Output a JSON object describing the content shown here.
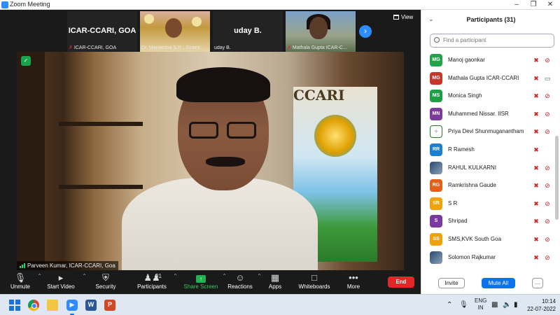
{
  "window": {
    "title": "Zoom Meeting"
  },
  "thumbnails": [
    {
      "big_name": "ICAR-CCARI, GOA",
      "label": "ICAR-CCARI, GOA",
      "muted": true
    },
    {
      "big_name": "",
      "label": "Dr. Maneesha S.R., Scienti...",
      "muted": false
    },
    {
      "big_name": "uday B.",
      "label": "uday B.",
      "muted": false
    },
    {
      "big_name": "",
      "label": "Mathala Gupta ICAR-C...",
      "muted": true
    }
  ],
  "view_label": "View",
  "main_video": {
    "speaker": "Parveen Kumar, ICAR-CCARI, Goa",
    "poster_text": "CCARI"
  },
  "toolbar": {
    "unmute": "Unmute",
    "start_video": "Start Video",
    "security": "Security",
    "participants": "Participants",
    "participants_count": "31",
    "share_screen": "Share Screen",
    "reactions": "Reactions",
    "apps": "Apps",
    "whiteboards": "Whiteboards",
    "more": "More",
    "end": "End"
  },
  "panel": {
    "title": "Participants (31)",
    "search_placeholder": "Find a participant",
    "participants": [
      {
        "initials": "MG",
        "name": "Manoj gaonkar",
        "color": "#22a34a",
        "avatar": "initials",
        "mic": "off",
        "video": "off"
      },
      {
        "initials": "MG",
        "name": "Mathala Gupta ICAR-CCARI",
        "color": "#c8362b",
        "avatar": "initials",
        "mic": "off",
        "video": "on"
      },
      {
        "initials": "MS",
        "name": "Monica Singh",
        "color": "#1f9e46",
        "avatar": "initials",
        "mic": "off",
        "video": "off"
      },
      {
        "initials": "MN",
        "name": "Muhammed Nissar. IISR",
        "color": "#7c3a9a",
        "avatar": "initials",
        "mic": "off",
        "video": "off"
      },
      {
        "initials": "",
        "name": "Priya Devi Shunmuganantham",
        "color": "#2a7a2a",
        "avatar": "logo",
        "mic": "off",
        "video": "off"
      },
      {
        "initials": "RR",
        "name": "R Ramesh",
        "color": "#1f7fcf",
        "avatar": "initials",
        "mic": "off",
        "video": "none"
      },
      {
        "initials": "",
        "name": "RAHUL KULKARNI",
        "color": "#2a4a70",
        "avatar": "photo",
        "mic": "off",
        "video": "off"
      },
      {
        "initials": "RG",
        "name": "Ramkrishna Gaude",
        "color": "#e2601a",
        "avatar": "initials",
        "mic": "off",
        "video": "off"
      },
      {
        "initials": "SR",
        "name": "S R",
        "color": "#f0a20c",
        "avatar": "initials",
        "mic": "off",
        "video": "off"
      },
      {
        "initials": "S",
        "name": "Shripad",
        "color": "#7a3aa0",
        "avatar": "initials",
        "mic": "off",
        "video": "off"
      },
      {
        "initials": "SS",
        "name": "SMS,KVK South Goa",
        "color": "#f0a20c",
        "avatar": "initials",
        "mic": "off",
        "video": "off"
      },
      {
        "initials": "",
        "name": "Solomon Rajkumar",
        "color": "#2a4a70",
        "avatar": "photo",
        "mic": "off",
        "video": "off"
      }
    ],
    "invite": "Invite",
    "mute_all": "Mute All",
    "more": "..."
  },
  "taskbar": {
    "lang": "ENG",
    "region": "IN",
    "time": "10:14",
    "date": "22-07-2022"
  }
}
